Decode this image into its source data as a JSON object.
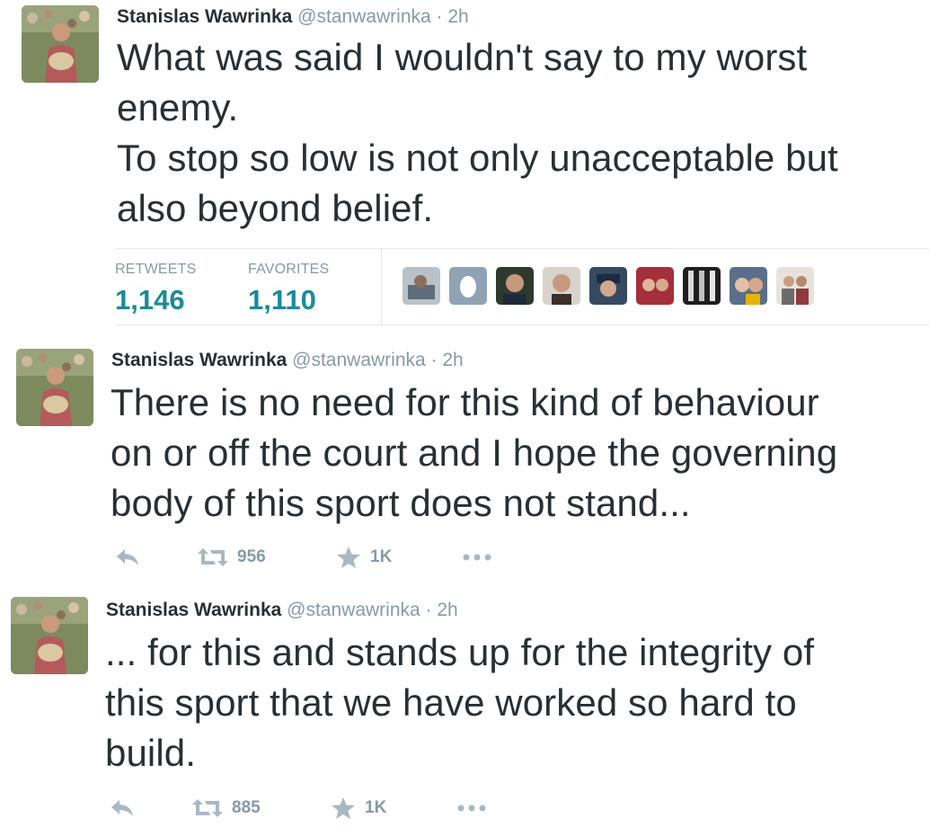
{
  "tweets": [
    {
      "name": "Stanislas Wawrinka",
      "handle": "@stanwawrinka",
      "separator": "·",
      "time": "2h",
      "text": "What was said I wouldn't say to my worst\nenemy.\nTo stop so low is not only unacceptable but\nalso beyond belief.",
      "stats": {
        "retweets_label": "RETWEETS",
        "retweets_value": "1,146",
        "favorites_label": "FAVORITES",
        "favorites_value": "1,110"
      },
      "favoriter_avatars": [
        "avatar-1",
        "avatar-egg",
        "avatar-3",
        "avatar-4",
        "avatar-5",
        "avatar-6",
        "avatar-7",
        "avatar-8",
        "avatar-9"
      ]
    },
    {
      "name": "Stanislas Wawrinka",
      "handle": "@stanwawrinka",
      "separator": "·",
      "time": "2h",
      "text": "There is no need for this kind of behaviour\non or off the court and I hope the governing\nbody of this sport does not stand...",
      "actions": {
        "reply_icon": "reply-icon",
        "retweet_icon": "retweet-icon",
        "retweet_count": "956",
        "favorite_icon": "star-icon",
        "favorite_count": "1K",
        "more_icon": "more-dots-icon"
      }
    },
    {
      "name": "Stanislas Wawrinka",
      "handle": "@stanwawrinka",
      "separator": "·",
      "time": "2h",
      "text": "... for this and stands up for the integrity of\nthis sport that we have worked so hard to\nbuild.",
      "actions": {
        "reply_icon": "reply-icon",
        "retweet_icon": "retweet-icon",
        "retweet_count": "885",
        "favorite_icon": "star-icon",
        "favorite_count": "1K",
        "more_icon": "more-dots-icon"
      }
    }
  ],
  "colors": {
    "stat_value": "#1a8a9a",
    "meta_text": "#8899a6",
    "action_icon": "#aab8c2",
    "divider": "#e1e8ed"
  }
}
